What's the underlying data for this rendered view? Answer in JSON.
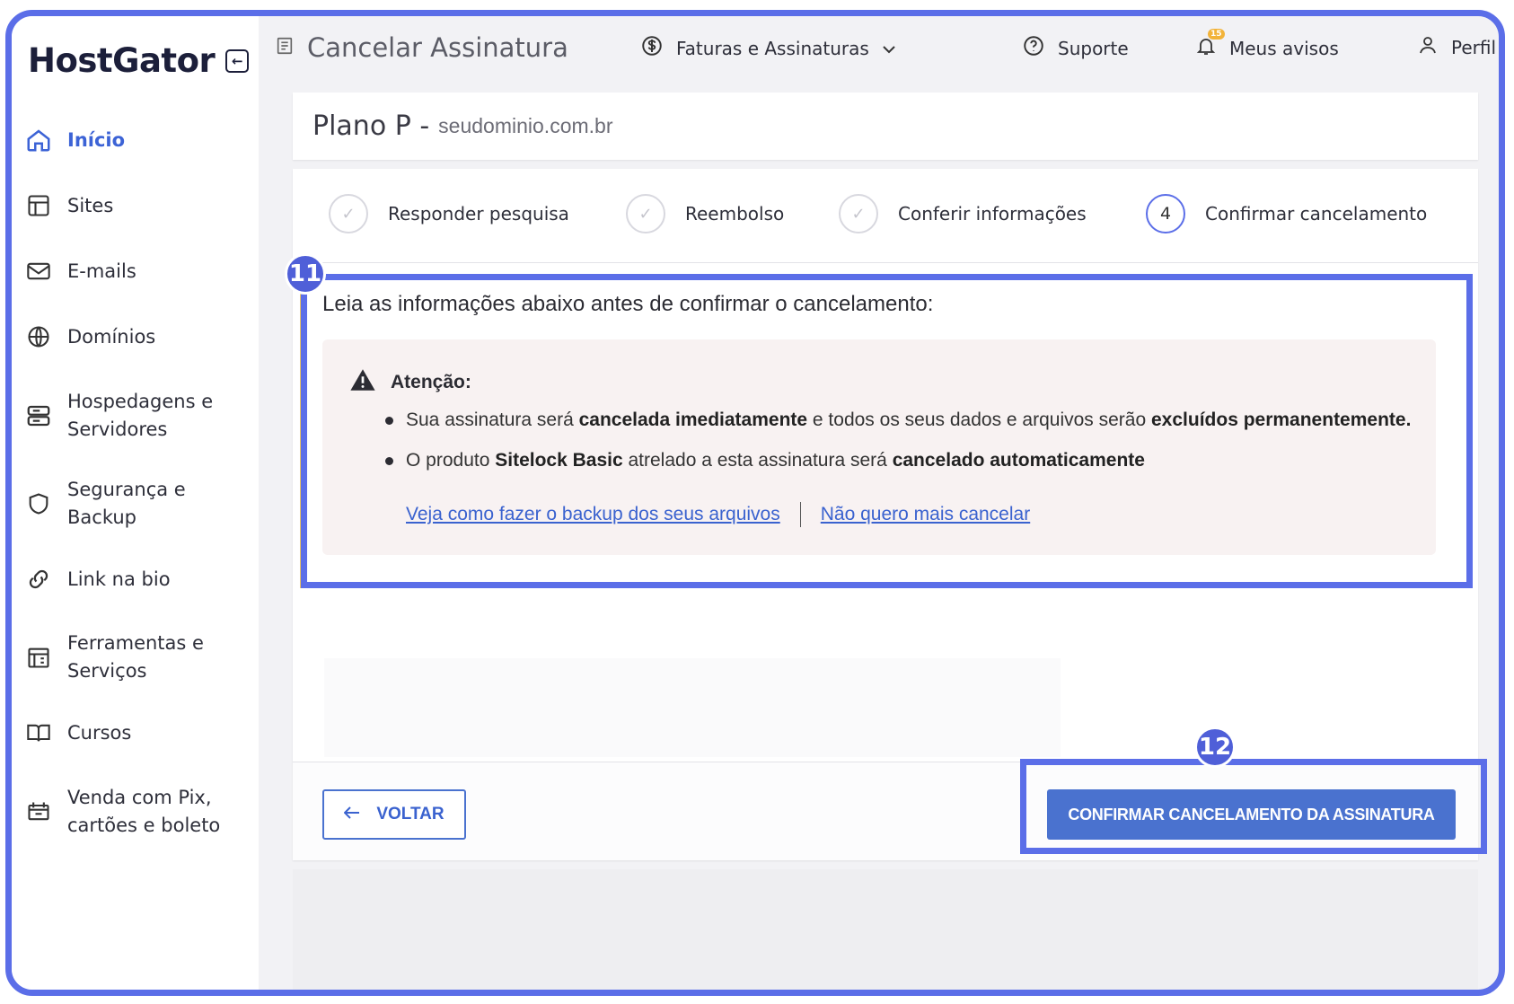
{
  "brand": {
    "name": "HostGator"
  },
  "sidebar": {
    "items": [
      {
        "label": "Início",
        "icon": "home-icon",
        "active": true
      },
      {
        "label": "Sites",
        "icon": "browser-window-icon"
      },
      {
        "label": "E-mails",
        "icon": "envelope-icon"
      },
      {
        "label": "Domínios",
        "icon": "globe-icon"
      },
      {
        "label": "Hospedagens e Servidores",
        "icon": "server-icon"
      },
      {
        "label": "Segurança e Backup",
        "icon": "shield-icon"
      },
      {
        "label": "Link na bio",
        "icon": "link-icon"
      },
      {
        "label": "Ferramentas e Serviços",
        "icon": "tools-icon"
      },
      {
        "label": "Cursos",
        "icon": "book-icon"
      },
      {
        "label": "Venda com Pix, cartões e boleto",
        "icon": "payment-icon"
      }
    ]
  },
  "topbar": {
    "page_title": "Cancelar Assinatura",
    "billing_label": "Faturas e Assinaturas",
    "support_label": "Suporte",
    "notices_label": "Meus avisos",
    "notices_count": "15",
    "profile_label": "Perfil"
  },
  "plan": {
    "name": "Plano P -",
    "domain": "seudominio.com.br"
  },
  "steps": [
    {
      "label": "Responder pesquisa",
      "state": "done"
    },
    {
      "label": "Reembolso",
      "state": "done"
    },
    {
      "label": "Conferir informações",
      "state": "done"
    },
    {
      "label": "Confirmar cancelamento",
      "state": "current",
      "number": "4"
    }
  ],
  "info": {
    "heading": "Leia as informações abaixo antes de confirmar o cancelamento:",
    "warning_title": "Atenção:",
    "bullet1": {
      "t1": "Sua assinatura será ",
      "b1": "cancelada imediatamente",
      "t2": " e todos os seus dados e arquivos serão ",
      "b2": "excluídos permanentemente."
    },
    "bullet2": {
      "t1": "O produto ",
      "b1": "Sitelock Basic",
      "t2": " atrelado a esta assinatura será ",
      "b2": "cancelado automaticamente"
    },
    "link_backup": "Veja como fazer o backup dos seus arquivos",
    "link_keep": "Não quero mais cancelar"
  },
  "footer": {
    "back_label": "VOLTAR",
    "confirm_label": "CONFIRMAR CANCELAMENTO DA ASSINATURA"
  },
  "annotations": {
    "first": "11",
    "second": "12"
  },
  "colors": {
    "accent": "#5b6ee8",
    "primary_button": "#4a72cf",
    "link": "#3a62cf",
    "warning_bg": "#f8f2f2"
  }
}
